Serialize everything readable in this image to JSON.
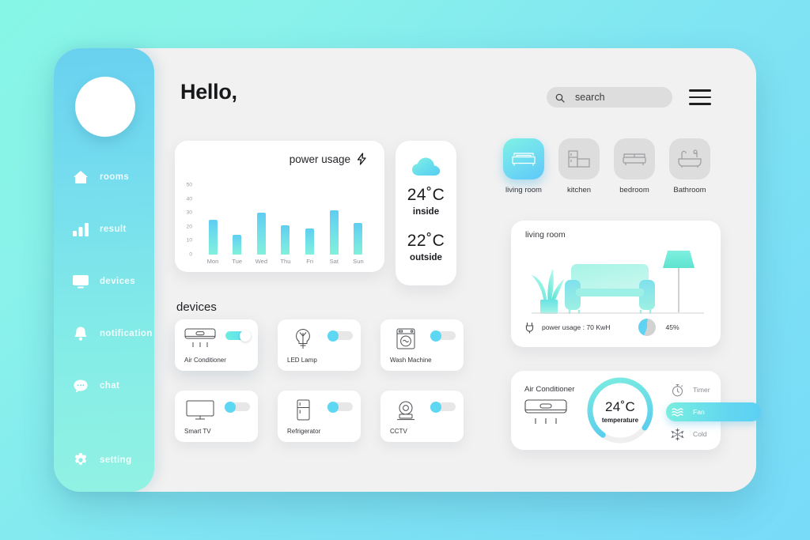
{
  "header": {
    "greeting": "Hello,",
    "search_placeholder": "search",
    "search_value": "",
    "menu_icon": "hamburger-menu-icon"
  },
  "sidebar": {
    "items": [
      {
        "label": "rooms",
        "icon": "home-icon"
      },
      {
        "label": "result",
        "icon": "bar-chart-icon"
      },
      {
        "label": "devices",
        "icon": "monitor-icon"
      },
      {
        "label": "notification",
        "icon": "bell-icon"
      },
      {
        "label": "chat",
        "icon": "chat-bubble-icon"
      }
    ],
    "setting": {
      "label": "setting",
      "icon": "gear-icon"
    }
  },
  "chart_data": {
    "type": "bar",
    "title": "power usage",
    "categories": [
      "Mon",
      "Tue",
      "Wed",
      "Thu",
      "Fri",
      "Sat",
      "Sun"
    ],
    "values": [
      25,
      14,
      30,
      21,
      19,
      32,
      23
    ],
    "yticks": [
      50,
      40,
      30,
      20,
      10,
      0
    ],
    "ylim": [
      0,
      50
    ],
    "xlabel": "",
    "ylabel": "",
    "grid": false,
    "legend": false,
    "bar_color_top": "#5fcdf1",
    "bar_color_bottom": "#82f0dc"
  },
  "weather": {
    "icon": "cloud-icon",
    "inside_temp": "24˚C",
    "inside_label": "inside",
    "outside_temp": "22˚C",
    "outside_label": "outside"
  },
  "rooms": [
    {
      "label": "living room",
      "icon": "sofa-icon",
      "active": true
    },
    {
      "label": "kitchen",
      "icon": "kitchen-counter-icon",
      "active": false
    },
    {
      "label": "bedroom",
      "icon": "bed-icon",
      "active": false
    },
    {
      "label": "Bathroom",
      "icon": "bathtub-icon",
      "active": false
    }
  ],
  "devices": {
    "title": "devices",
    "items": [
      {
        "label": "Air Conditioner",
        "icon": "air-conditioner-icon",
        "on": true
      },
      {
        "label": "LED Lamp",
        "icon": "light-bulb-icon",
        "on": false
      },
      {
        "label": "Wash Machine",
        "icon": "washing-machine-icon",
        "on": false
      },
      {
        "label": "Smart TV",
        "icon": "television-icon",
        "on": false
      },
      {
        "label": "Refrigerator",
        "icon": "refrigerator-icon",
        "on": false
      },
      {
        "label": "CCTV",
        "icon": "security-camera-icon",
        "on": false
      }
    ]
  },
  "living_room": {
    "title": "living room",
    "power_usage": "power usage : 70 KwH",
    "percent": "45%",
    "percent_value": 45,
    "plug_icon": "power-plug-icon"
  },
  "ac_control": {
    "name": "Air Conditioner",
    "icon": "air-conditioner-icon",
    "temperature": "24˚C",
    "temperature_label": "temperature",
    "modes": [
      {
        "label": "Timer",
        "icon": "stopwatch-icon",
        "active": false
      },
      {
        "label": "Fan",
        "icon": "fan-waves-icon",
        "active": true
      },
      {
        "label": "Cold",
        "icon": "snowflake-icon",
        "active": false
      }
    ]
  },
  "colors": {
    "accent_blue": "#5fd0f0",
    "accent_mint": "#82f0dc",
    "panel": "#f2f1f1",
    "card": "#ffffff"
  }
}
